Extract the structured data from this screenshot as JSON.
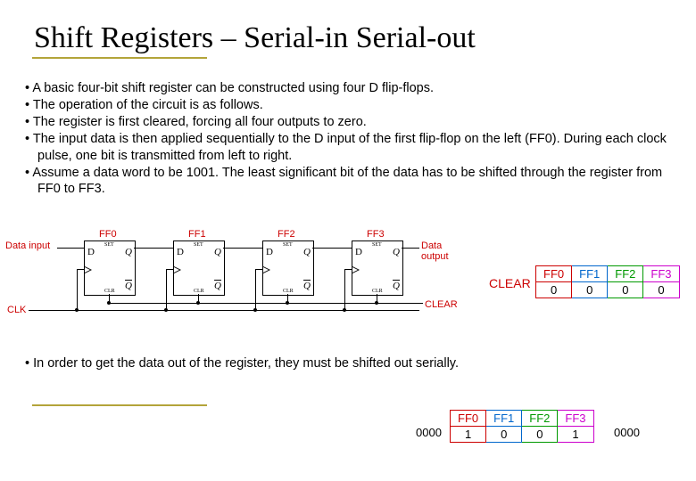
{
  "title": "Shift Registers – Serial-in Serial-out",
  "bullets1": [
    "A basic four-bit shift register can be constructed using four D flip-flops.",
    "The operation of the circuit is as follows.",
    "The register is first cleared, forcing all four outputs to zero.",
    "The input data is then applied sequentially to the D input of the first flip-flop on the left (FF0).  During each clock pulse, one bit is transmitted from left to right.",
    "Assume a data word to be 1001.  The least significant bit of the data has to be shifted through the register from FF0 to FF3."
  ],
  "bullets2": [
    "In order to get the data out of the register, they must be shifted out serially."
  ],
  "signals": {
    "data_in": "Data input",
    "data_out": "Data output",
    "clk": "CLK",
    "clear": "CLEAR",
    "clear2": "CLEAR"
  },
  "ff": [
    {
      "name": "FF0"
    },
    {
      "name": "FF1"
    },
    {
      "name": "FF2"
    },
    {
      "name": "FF3"
    }
  ],
  "pins": {
    "d": "D",
    "q": "Q",
    "qb": "Q",
    "set": "SET",
    "clr": "CLR"
  },
  "clear_table": {
    "label": "CLEAR",
    "headers": [
      "FF0",
      "FF1",
      "FF2",
      "FF3"
    ],
    "values": [
      "0",
      "0",
      "0",
      "0"
    ]
  },
  "result_table": {
    "left": "0000",
    "right": "0000",
    "headers": [
      "FF0",
      "FF1",
      "FF2",
      "FF3"
    ],
    "values": [
      "1",
      "0",
      "0",
      "1"
    ]
  }
}
